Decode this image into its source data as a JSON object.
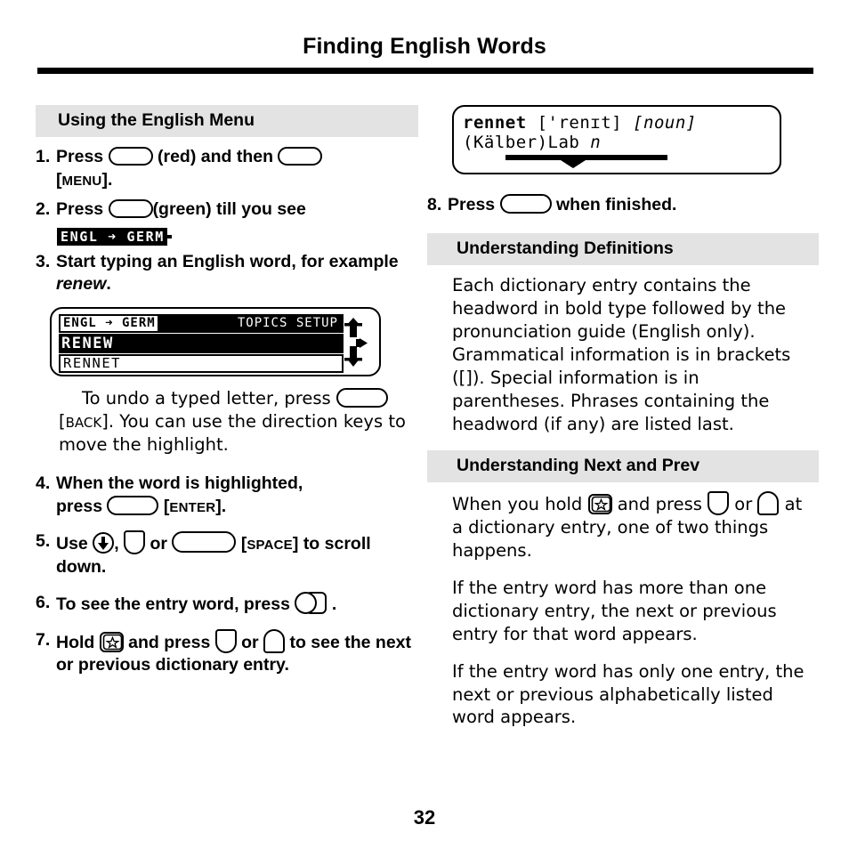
{
  "page": {
    "title": "Finding English Words",
    "number": "32"
  },
  "left_column": {
    "section_heading": "Using the English Menu",
    "steps": [
      {
        "num": "1.",
        "text_before_key": "Press",
        "key1": "red-key-pill",
        "text_mid": "(red) and then",
        "key2": "menu-key-pill",
        "bracket_label": "MENU",
        "text_after": "."
      },
      {
        "num": "2.",
        "text_before_key": "Press",
        "key1": "green-key-pill",
        "text_after": "(green) till you see"
      },
      {
        "num": "3.",
        "text": "Start typing an English word, for example ",
        "italic_word": "renew",
        "text_end": "."
      },
      {
        "num": "4.",
        "line1": "When the word is highlighted,",
        "text_before_key": "press",
        "key1": "enter-key-pill",
        "bracket_label": "ENTER",
        "text_after": "."
      },
      {
        "num": "5.",
        "text_before_key": "Use",
        "icon1": "arrow-down-circle-icon",
        "sep1": ",",
        "icon2": "next-key-icon",
        "sep2": "or",
        "key1": "space-key-pill",
        "bracket_label": "SPACE",
        "text_after": "to scroll down."
      },
      {
        "num": "6.",
        "text_before_key": "To see the entry word, press",
        "icon1": "enter-card-icon",
        "text_after": "."
      },
      {
        "num": "7.",
        "text_before_key": "Hold",
        "icon1": "star-key-icon",
        "sep1": "and press",
        "icon2": "next-key-icon",
        "sep2": "or",
        "icon3": "prev-key-icon",
        "text_after": "to see the next or previous dictionary entry."
      }
    ],
    "menu_badge": {
      "text": "ENGL ➜ GERM"
    },
    "lcd": {
      "tab_active": "ENGL ➜ GERM",
      "tabs_rest": "TOPICS SETUP",
      "highlighted_word": "RENEW",
      "list_word": "RENNET",
      "scroll_indicator": "up-down-scroll-icon"
    },
    "note": {
      "text_before_key": "To undo a typed letter, press",
      "key": "back-key-pill",
      "bracket_label": "BACK",
      "text_after": ". You can use the direction keys to move the highlight."
    }
  },
  "right_column": {
    "lcd": {
      "headword": "rennet",
      "pronunciation": "['renɪt]",
      "part_of_speech": "[noun]",
      "definition": "(Kälber)Lab",
      "definition_gender": "n",
      "underline_marker": "scroll-marker-icon"
    },
    "step8": {
      "num": "8.",
      "text_before_key": "Press",
      "key": "finish-key-pill",
      "text_after": "when finished."
    },
    "sections": [
      {
        "heading": "Understanding Definitions",
        "paragraphs": [
          "Each dictionary entry contains the headword in bold type followed by the pronunciation guide (English only). Grammatical information is in brackets ([]). Special information is in parentheses. Phrases containing the headword (if any) are listed last."
        ]
      },
      {
        "heading": "Understanding Next and Prev",
        "para1_before": "When you hold",
        "para1_icon1": "star-key-icon",
        "para1_mid": "and press",
        "para1_icon2": "next-key-icon",
        "para1_or": "or",
        "para1_icon3": "prev-key-icon",
        "para1_after": "at a dictionary entry, one of two things happens.",
        "paragraphs": [
          "If the entry word has more than one dictionary entry, the next or previous entry for that word appears.",
          "If the entry word has only one entry, the next or previous alphabetically listed word appears."
        ]
      }
    ]
  },
  "colors": {
    "section_band": "#e3e3e3",
    "text": "#000000",
    "background": "#ffffff"
  }
}
